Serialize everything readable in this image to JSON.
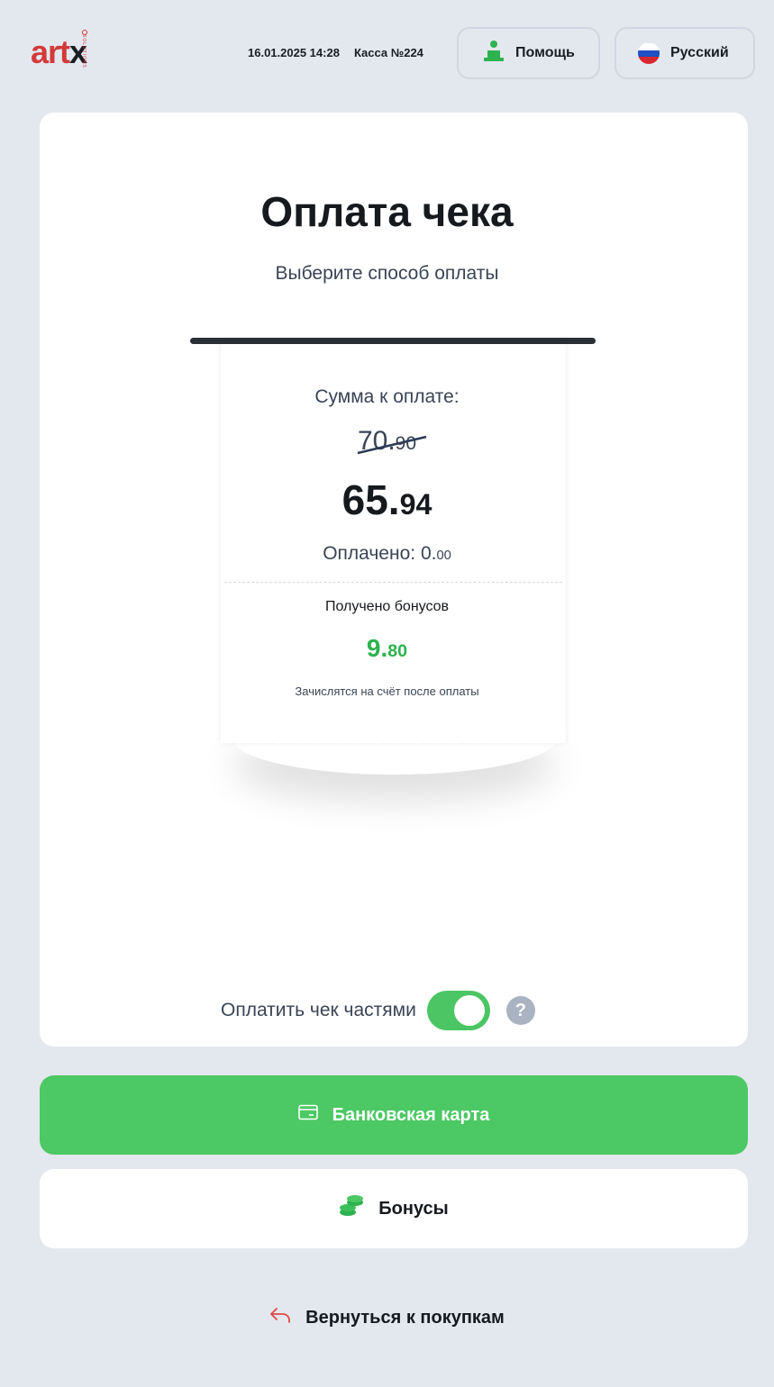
{
  "header": {
    "logo_text": "artx",
    "logo_subtext": "SOLUTIONS",
    "datetime": "16.01.2025 14:28",
    "register": "Касса №224",
    "help_label": "Помощь",
    "language_label": "Русский"
  },
  "payment": {
    "title": "Оплата чека",
    "subtitle": "Выберите способ оплаты",
    "sum_label": "Сумма к оплате:",
    "old_int": "70.",
    "old_dec": "90",
    "total_int": "65.",
    "total_dec": "94",
    "paid_label": "Оплачено: ",
    "paid_int": "0.",
    "paid_dec": "00",
    "bonus_label": "Получено бонусов",
    "bonus_int": "9.",
    "bonus_dec": "80",
    "bonus_note": "Зачислятся на счёт после оплаты",
    "split_label": "Оплатить чек частями",
    "split_enabled": true,
    "help_mark": "?"
  },
  "buttons": {
    "bank_card": "Банковская карта",
    "bonuses": "Бонусы",
    "back": "Вернуться к покупкам"
  },
  "colors": {
    "accent_green": "#4cc864",
    "bonus_green": "#2db24f",
    "brand_red": "#d23a3a",
    "background": "#e3e8ee"
  }
}
